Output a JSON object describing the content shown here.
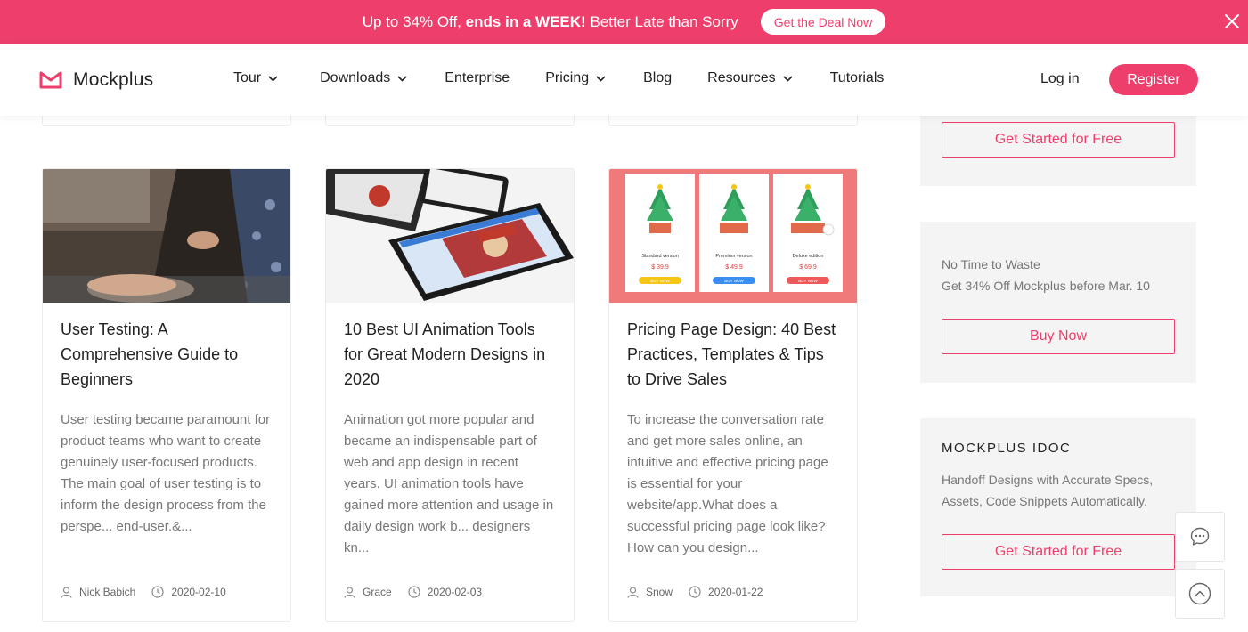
{
  "promo": {
    "text_before": "Up to 34% Off, ",
    "text_bold": "ends in a WEEK!",
    "text_after": " Better Late than Sorry",
    "cta": "Get the Deal Now"
  },
  "nav": {
    "brand": "Mockplus",
    "items": [
      {
        "label": "Tour",
        "dropdown": true
      },
      {
        "label": "Downloads",
        "dropdown": true
      },
      {
        "label": "Enterprise",
        "dropdown": false
      },
      {
        "label": "Pricing",
        "dropdown": true
      },
      {
        "label": "Blog",
        "dropdown": false
      },
      {
        "label": "Resources",
        "dropdown": true
      },
      {
        "label": "Tutorials",
        "dropdown": false
      }
    ],
    "login": "Log in",
    "register": "Register"
  },
  "articles": [
    {
      "title": "User Testing: A Comprehensive Guide to Beginners",
      "excerpt": "User testing became paramount for product teams who want to create genuinely user-focused products. The main goal of user testing is to inform the design process from the perspe... end-user.&...",
      "author": "Nick Babich",
      "date": "2020-02-10"
    },
    {
      "title": "10 Best UI Animation Tools for Great Modern Designs in 2020",
      "excerpt": "Animation got more popular and became an indispensable part of web and app design in recent years. UI animation tools have gained more attention and usage in daily design work b... designers kn...",
      "author": "Grace",
      "date": "2020-02-03"
    },
    {
      "title": "Pricing Page Design: 40 Best Practices, Templates & Tips to Drive Sales",
      "excerpt": "To increase the conversation rate and get more sales online, an intuitive and effective pricing page is essential for your website/app.What does a successful pricing page look like? How can you design...",
      "author": "Snow",
      "date": "2020-01-22"
    }
  ],
  "pricing_thumb": {
    "plans": [
      {
        "name": "Standard version",
        "price": "$ 39.9",
        "button": "BUY NOW",
        "color": "#f5c518"
      },
      {
        "name": "Premium version",
        "price": "$ 49.9",
        "button": "BUY NOW",
        "color": "#3b8ff0"
      },
      {
        "name": "Deluxe edition",
        "price": "$ 69.9",
        "button": "BUY NOW",
        "color": "#ee5a5a"
      }
    ]
  },
  "sidebar": {
    "box1": {
      "cta": "Get Started for Free"
    },
    "box2": {
      "line1": "No Time to Waste",
      "line2": "Get 34% Off Mockplus before Mar. 10",
      "cta": "Buy Now"
    },
    "box3": {
      "heading": "MOCKPLUS IDOC",
      "desc_line1": "Handoff Designs with Accurate Specs,",
      "desc_line2": "Assets, Code Snippets Automatically.",
      "cta": "Get Started for Free"
    }
  },
  "colors": {
    "brand": "#ee3f6c",
    "sidebar_bg": "#f5f4f5"
  }
}
